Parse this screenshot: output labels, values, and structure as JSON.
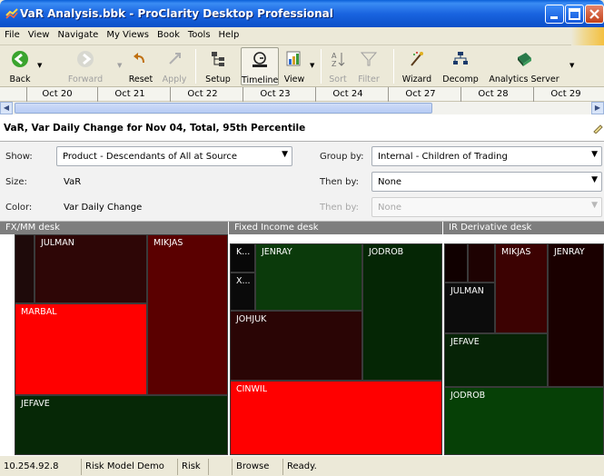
{
  "window": {
    "title": "VaR Analysis.bbk - ProClarity Desktop Professional"
  },
  "menu": [
    "File",
    "View",
    "Navigate",
    "My Views",
    "Book",
    "Tools",
    "Help"
  ],
  "toolbar": {
    "back": "Back",
    "forward": "Forward",
    "reset": "Reset",
    "apply": "Apply",
    "setup": "Setup",
    "timeline": "Timeline",
    "view": "View",
    "sort": "Sort",
    "filter": "Filter",
    "wizard": "Wizard",
    "decomp": "Decomp",
    "analytics_server": "Analytics Server"
  },
  "timeline": [
    "Oct 20",
    "Oct 21",
    "Oct 22",
    "Oct 23",
    "Oct 24",
    "Oct 27",
    "Oct 28",
    "Oct 29"
  ],
  "header": {
    "title": "VaR, Var Daily Change for Nov 04, Total, 95th Percentile"
  },
  "settings": {
    "show_label": "Show:",
    "show_value": "Product - Descendants of All at Source",
    "size_label": "Size:",
    "size_value": "VaR",
    "color_label": "Color:",
    "color_value": "Var Daily Change",
    "groupby_label": "Group by:",
    "groupby_value": "Internal - Children of Trading",
    "thenby1_label": "Then by:",
    "thenby1_value": "None",
    "thenby2_label": "Then by:",
    "thenby2_value": "None"
  },
  "treemap": {
    "desks": [
      {
        "name": "FX/MM desk",
        "cells": [
          {
            "label": "",
            "color": "#1e0a0a"
          },
          {
            "label": "JULMAN",
            "color": "#2e0606"
          },
          {
            "label": "MIKJAS",
            "color": "#5a0000"
          },
          {
            "label": "MARBAL",
            "color": "#ff0000"
          },
          {
            "label": "JEFAVE",
            "color": "#062806"
          }
        ]
      },
      {
        "name": "Fixed Income desk",
        "cells": [
          {
            "label": "K...",
            "color": "#080808"
          },
          {
            "label": "JENRAY",
            "color": "#0b3a0b"
          },
          {
            "label": "JODROB",
            "color": "#052605"
          },
          {
            "label": "X...",
            "color": "#0a0a0a"
          },
          {
            "label": "JOHJUK",
            "color": "#2a0505"
          },
          {
            "label": "CINWIL",
            "color": "#ff0000"
          }
        ]
      },
      {
        "name": "IR Derivative desk",
        "cells": [
          {
            "label": "",
            "color": "#100000"
          },
          {
            "label": "",
            "color": "#1e0202"
          },
          {
            "label": "MIKJAS",
            "color": "#3c0202"
          },
          {
            "label": "JENRAY",
            "color": "#1a0000"
          },
          {
            "label": "JULMAN",
            "color": "#0c0c0c"
          },
          {
            "label": "JEFAVE",
            "color": "#062306"
          },
          {
            "label": "JODROB",
            "color": "#064006"
          }
        ]
      }
    ]
  },
  "status": {
    "ip": "10.254.92.8",
    "model": "Risk Model Demo",
    "risk": "Risk",
    "mode": "Browse",
    "state": "Ready."
  }
}
